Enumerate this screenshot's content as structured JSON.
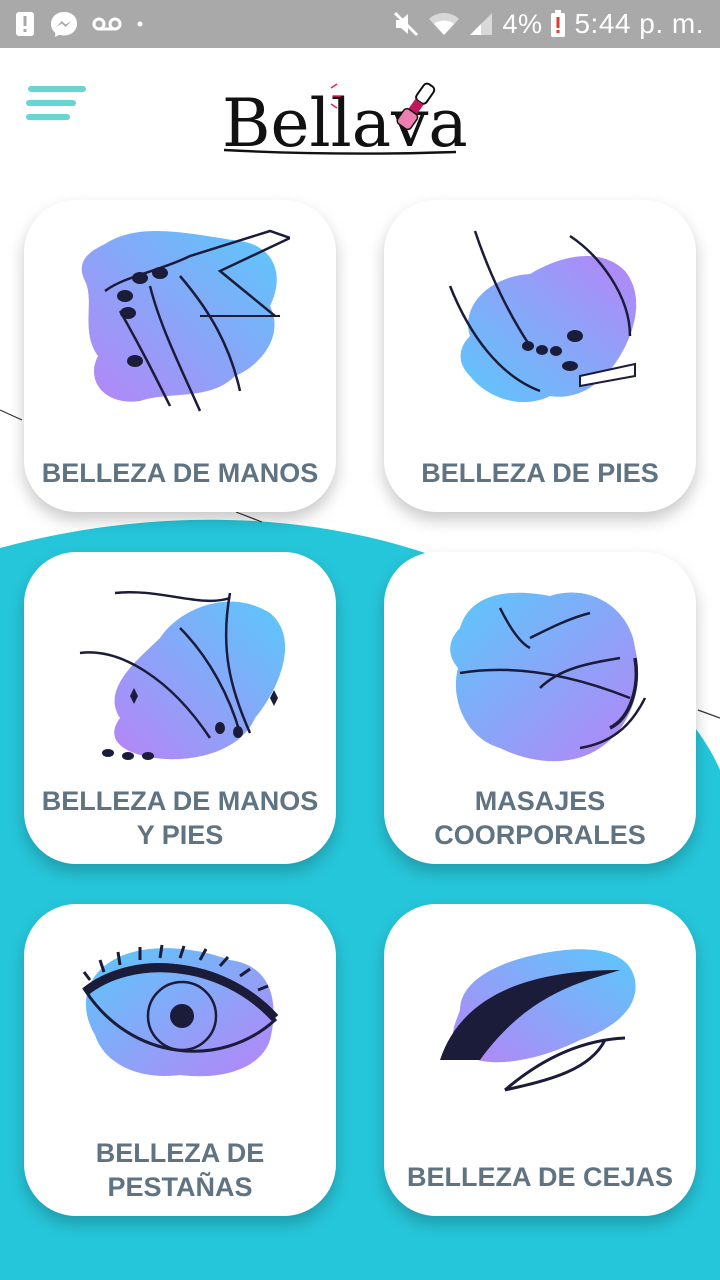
{
  "status_bar": {
    "battery_percent": "4%",
    "time": "5:44 p. m.",
    "icons_left": [
      "notification-alert-icon",
      "messenger-icon",
      "voicemail-icon",
      "dot-icon"
    ],
    "icons_right": [
      "mute-icon",
      "wifi-icon",
      "signal-icon",
      "battery-alert-icon"
    ]
  },
  "header": {
    "menu_icon": "hamburger-menu-icon",
    "logo_text": "Bellava"
  },
  "colors": {
    "accent_teal": "#26c6da",
    "menu_teal": "#67d6d3",
    "label_gray": "#5f7382",
    "illus_purple": "#b784f7",
    "illus_blue": "#5ac8fa"
  },
  "services": [
    {
      "label": "BELLEZA DE MANOS",
      "icon": "hand-manicure-icon"
    },
    {
      "label": "BELLEZA DE PIES",
      "icon": "foot-pedicure-icon"
    },
    {
      "label": "BELLEZA DE MANOS Y PIES",
      "icon": "hands-and-feet-icon"
    },
    {
      "label": "MASAJES COORPORALES",
      "icon": "body-massage-icon"
    },
    {
      "label": "BELLEZA DE PESTAÑAS",
      "icon": "eyelashes-icon"
    },
    {
      "label": "BELLEZA DE CEJAS",
      "icon": "eyebrow-icon"
    }
  ]
}
